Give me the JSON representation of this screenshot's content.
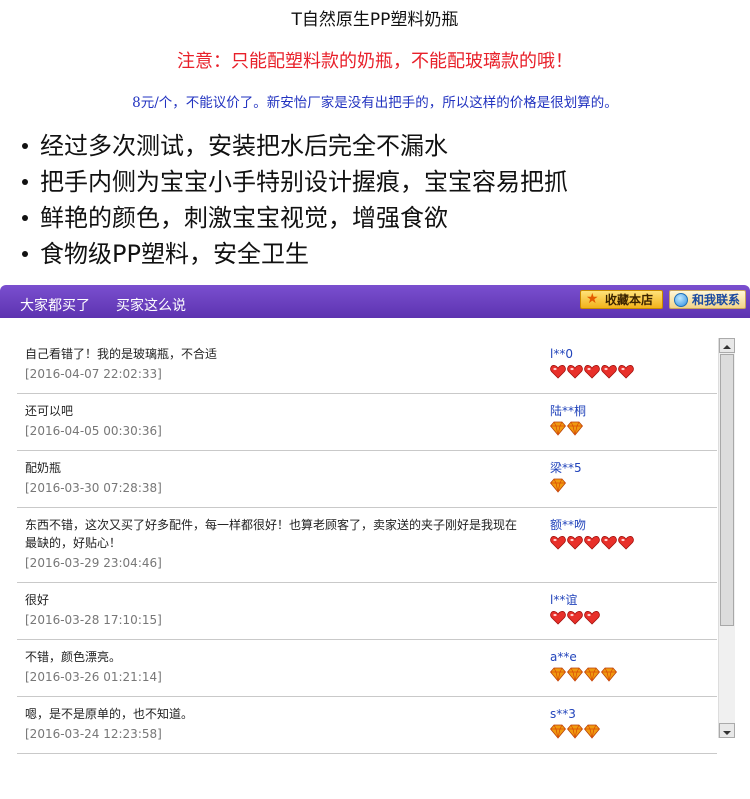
{
  "header": {
    "title": "T自然原生PP塑料奶瓶",
    "warning": "注意：只能配塑料款的奶瓶，不能配玻璃款的哦！",
    "price_note": "8元/个，不能议价了。新安怡厂家是没有出把手的，所以这样的价格是很划算的。"
  },
  "features": [
    "经过多次测试，安装把水后完全不漏水",
    "把手内侧为宝宝小手特别设计握痕，宝宝容易把抓",
    "鲜艳的颜色，刺激宝宝视觉，增强食欲",
    " 食物级PP塑料，安全卫生"
  ],
  "tabs": {
    "tab1": "大家都买了",
    "tab2": "买家这么说"
  },
  "buttons": {
    "favorite": "收藏本店",
    "contact": "和我联系"
  },
  "colors": {
    "bar": "#6a3fc0",
    "heart": "#e8302a",
    "diamond": "#f09a10",
    "user": "#2244bb"
  },
  "reviews": [
    {
      "comment": "自己看错了！我的是玻璃瓶，不合适",
      "date": "[2016-04-07 22:02:33]",
      "user": "l**0",
      "badge_type": "heart",
      "badge_count": 5
    },
    {
      "comment": "还可以吧",
      "date": "[2016-04-05 00:30:36]",
      "user": "陆**桐",
      "badge_type": "diamond",
      "badge_count": 2
    },
    {
      "comment": "配奶瓶",
      "date": "[2016-03-30 07:28:38]",
      "user": "梁**5",
      "badge_type": "diamond",
      "badge_count": 1
    },
    {
      "comment": "东西不错，这次又买了好多配件，每一样都很好！也算老顾客了，卖家送的夹子刚好是我现在最缺的，好贴心！",
      "date": "[2016-03-29 23:04:46]",
      "user": "额**吻",
      "badge_type": "heart",
      "badge_count": 5
    },
    {
      "comment": "很好",
      "date": "[2016-03-28 17:10:15]",
      "user": "l**谊",
      "badge_type": "heart",
      "badge_count": 3
    },
    {
      "comment": "不错，颜色漂亮。",
      "date": "[2016-03-26 01:21:14]",
      "user": "a**e",
      "badge_type": "diamond",
      "badge_count": 4
    },
    {
      "comment": "嗯，是不是原单的，也不知道。",
      "date": "[2016-03-24 12:23:58]",
      "user": "s**3",
      "badge_type": "diamond",
      "badge_count": 3
    }
  ]
}
